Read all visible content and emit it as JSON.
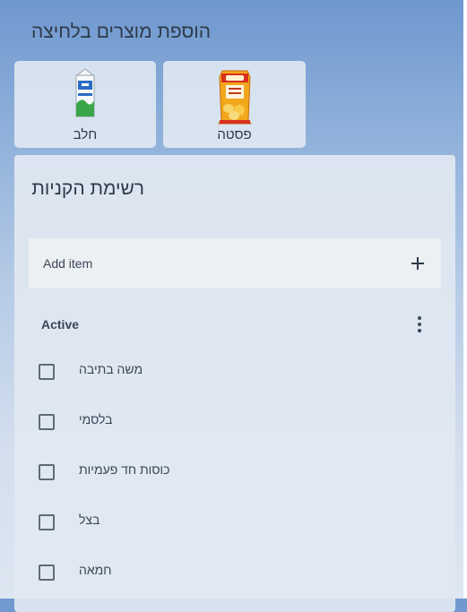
{
  "quick_add": {
    "title": "הוספת מוצרים בלחיצה",
    "items": [
      {
        "label": "פסטה",
        "icon": "pasta-package-icon"
      },
      {
        "label": "חלב",
        "icon": "milk-carton-icon"
      }
    ]
  },
  "shopping_list": {
    "title": "רשימת הקניות",
    "add_placeholder": "Add item",
    "active_label": "Active",
    "items": [
      "משה בתיבה",
      "בלסמי",
      "כוסות חד פעמיות",
      "בצל",
      "חמאה"
    ]
  },
  "colors": {
    "background_top": "#6f98cf",
    "background_bottom": "#dde6f1",
    "card": "#e2eaf3",
    "text": "#2e3a48"
  }
}
